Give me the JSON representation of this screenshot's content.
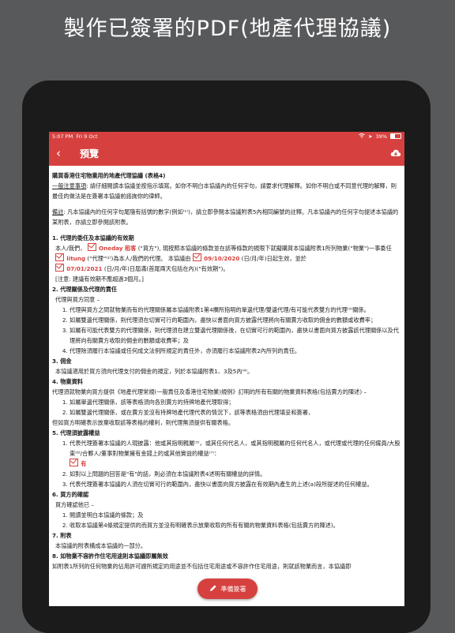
{
  "headline": "製作已簽署的PDF(地產代理協議)",
  "status_bar": {
    "time": "5:07 PM",
    "date": "Fri 9 Oct",
    "battery": "39%",
    "battery_level": 0.39
  },
  "nav": {
    "back_icon": "‹",
    "title": "預覽",
    "cloud_icon": "cloud-download-icon"
  },
  "doc": {
    "title": "購買香港住宅物業用的地產代理協議 (表格4)",
    "notice_label": "一般注意事項",
    "notice_text": ": 請仔細閱讀本協議並按指示填寫。如你不明白本協議內的任何字句，請要求代理解釋。如你不明白或不同意代理的解釋，則最佳的做法是在簽署本協議前諮詢你的律師。",
    "remark_label": "備註",
    "remark_text": ": 凡本協議內的任何字句尾隨有括號的數字(例如⁽¹⁾)，請立即參閱本協議附表5內相同編號的註釋。凡本協議內的任何字句提述本協議的某附表，亦請立即參閱該附表。",
    "s1_title": "1. 代理的委任及本協議的有效期",
    "s1_a": "本人/我們，",
    "s1_name": "Oneday 租客",
    "s1_b": "(\"買方\"), 現按照本協議的條款並在該等條款的規限下就擬購買本協議附表1所列物業(\"物業\")一事委任",
    "s1_agent": "litung",
    "s1_c": "(\"代理\"⁽²⁾)為本人/我們的代理。 本協議由",
    "s1_start": "09/10/2020",
    "s1_d": "(日/月/年)日起生效，並於",
    "s1_end": "07/01/2021",
    "s1_e": "(日/月/年)日屆滿(首尾兩天包括在內)(\"有效期\")。",
    "s1_note": "[注意: 建議有效期不應超過3個月。]",
    "s2_title": "2. 代理關係及代理的責任",
    "s2_intro": "代理與買方同意 –",
    "s2_items": [
      "代理與買方之間就物業而有的代理關係屬本協議附表1第4欄所指明的單邊代理/雙邊代理/有可能代表雙方的代理⁽³⁾關係。",
      "如屬雙邊代理關係，則代理須在切實可行的範圍內，盡快以書面向買方披露代理將向有關賣方收取的佣金的數額或收費率；",
      "如屬有可能代表雙方的代理關係，則代理須在建立雙邊代理關係後，在切實可行的範圍內，盡快以書面向買方披露該代理關係以及代理將向有關賣方收取的佣金的數額或收費率；及",
      "代理除須履行本協議或任何成文法例所規定的責任外，亦須履行本協議附表2內所列的責任。"
    ],
    "s3_title": "3. 佣金",
    "s3_text": "本協議適用於買方須向代理支付的佣金的規定，列於本協議附表1、3及5內⁽⁴⁾。",
    "s4_title": "4. 物業資料",
    "s4_intro": "代理須就物業向買方提供《地產代理常規(一般責任及香港住宅物業)規例》訂明的所有有關的物業資料表格(包括賣方的陳述) –",
    "s4_items": [
      "如屬單邊代理關係，該等表格須向各別賣方的持牌地產代理取得；",
      "如屬雙邊代理關係，或在賣方並沒有持牌地產代理代表的情況下，該等表格須由代理填妥和簽署，"
    ],
    "s4_tail": "但如買方明確表示放棄收取該等表格的權利，則代理無須提供有關表格。",
    "s5_title": "5. 代理須披露權益",
    "s5_items": [
      "代表代理簽署本協議的人現披露：他或其指明親屬⁽⁵⁾，或其任何代名人，或其指明親屬的任何代名人，或代理或代理的任何僱員/大股東⁽⁶⁾/合夥人/董事對物業擁有金錢上的或其他實益的權益⁽⁷⁾："
    ],
    "s5_choice": "有",
    "s5_items2": [
      "如對以上問題的回答是\"有\"的話，則必須在本協議附表4述明有關權益的詳情。",
      "代表代理簽署本協議的人須在切實可行的範圍內，盡快以書面向買方披露在有效期內產生的上述(a)段所提述的任何權益。"
    ],
    "s6_title": "6. 買方的確認",
    "s6_intro": "買方確認他已 –",
    "s6_items": [
      "閱讀並明白本協議的條款；及",
      "收取本協議第4條規定提供的而買方並沒有明確表示放棄收取的所有有關的物業資料表格(包括賣方的陳述)。"
    ],
    "s7_title": "7. 附表",
    "s7_text": "本協議的附表構成本協議的一部分。",
    "s8_title": "8. 如物業不容許作住宅用途則本協議即屬無效",
    "s8_text": "如附表1所列的任何物業的佔用許可證所規定的用途並不包括住宅用途或不容許作住宅用途，則就該物業而言，本協議即"
  },
  "fab": {
    "label": "準備簽署",
    "icon": "pen-icon"
  }
}
